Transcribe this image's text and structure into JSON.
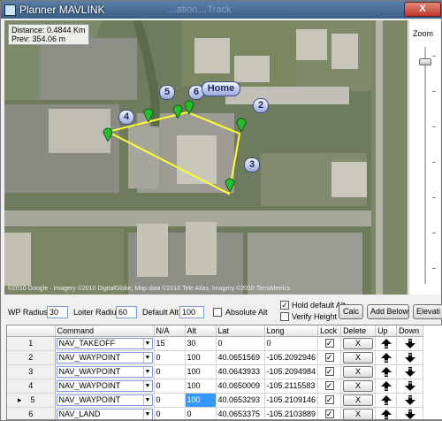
{
  "window": {
    "title": "Planner MAVLINK",
    "title_extra": "…ation…Track",
    "close_label": "X"
  },
  "map": {
    "distance": "Distance: 0.4844 Km",
    "prev": "Prev: 354.06 m",
    "copyright": "©2010 Google · Imagery ©2010 DigitalGlobe, Map data ©2010 Tele Atlas, Imagery ©2010 TerraMetrics",
    "labels": {
      "home": "Home",
      "wp2": "2",
      "wp3": "3",
      "wp4": "4",
      "wp5": "5",
      "wp6": "6"
    },
    "colors": {
      "route": "#ffff33",
      "pin": "#22c02a"
    }
  },
  "zoom": {
    "label": "Zoom",
    "level_fraction": 0.05
  },
  "controls": {
    "wp_radius_label": "WP Radius",
    "wp_radius_value": "30",
    "loiter_radius_label": "Loiter Radius",
    "loiter_radius_value": "60",
    "default_alt_label": "Default Alt",
    "default_alt_value": "100",
    "absolute_alt_label": "Absolute Alt",
    "hold_default_alt_label": "Hold default Alt",
    "verify_height_label": "Verify Height",
    "calc_label": "Calc",
    "add_below_label": "Add Below",
    "elevation_label": "Elevati"
  },
  "table": {
    "headers": [
      "Command",
      "N/A",
      "Alt",
      "Lat",
      "Long",
      "Lock",
      "Delete",
      "Up",
      "Down"
    ],
    "delete_label": "X",
    "check_mark": "✓",
    "row_pointer": "▸",
    "rows": [
      {
        "num": "1",
        "command": "NAV_TAKEOFF",
        "na": "15",
        "alt": "30",
        "lat": "0",
        "long": "0"
      },
      {
        "num": "2",
        "command": "NAV_WAYPOINT",
        "na": "0",
        "alt": "100",
        "lat": "40.0651569",
        "long": "-105.2092946"
      },
      {
        "num": "3",
        "command": "NAV_WAYPOINT",
        "na": "0",
        "alt": "100",
        "lat": "40.0643933",
        "long": "-105.2094984"
      },
      {
        "num": "4",
        "command": "NAV_WAYPOINT",
        "na": "0",
        "alt": "100",
        "lat": "40.0650009",
        "long": "-105.2115583"
      },
      {
        "num": "5",
        "command": "NAV_WAYPOINT",
        "na": "0",
        "alt": "100",
        "lat": "40.0653293",
        "long": "-105.2109146"
      },
      {
        "num": "6",
        "command": "NAV_LAND",
        "na": "0",
        "alt": "0",
        "lat": "40.0653375",
        "long": "-105.2103889"
      }
    ]
  }
}
